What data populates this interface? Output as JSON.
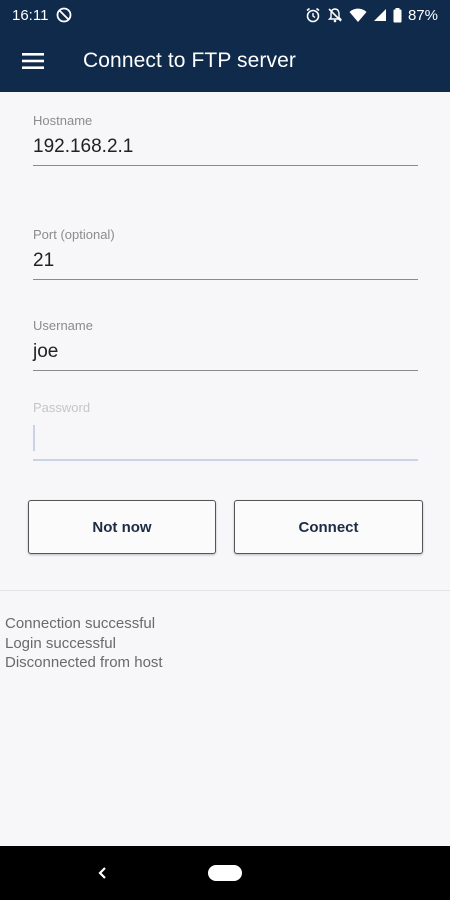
{
  "status_bar": {
    "time": "16:11",
    "battery": "87%",
    "icons": [
      "do-not-disturb-icon",
      "alarm-icon",
      "notifications-off-icon",
      "wifi-icon",
      "signal-icon",
      "battery-icon"
    ]
  },
  "app_bar": {
    "title": "Connect to FTP server",
    "menu_icon": "hamburger-menu-icon",
    "background": "#0f2a4a"
  },
  "form": {
    "hostname": {
      "label": "Hostname",
      "value": "192.168.2.1"
    },
    "port": {
      "label": "Port (optional)",
      "value": "21"
    },
    "username": {
      "label": "Username",
      "value": "joe"
    },
    "password": {
      "label": "Password",
      "value": ""
    }
  },
  "buttons": {
    "not_now": "Not now",
    "connect": "Connect"
  },
  "log": [
    "Connection successful",
    "Login successful",
    "Disconnected from host"
  ]
}
